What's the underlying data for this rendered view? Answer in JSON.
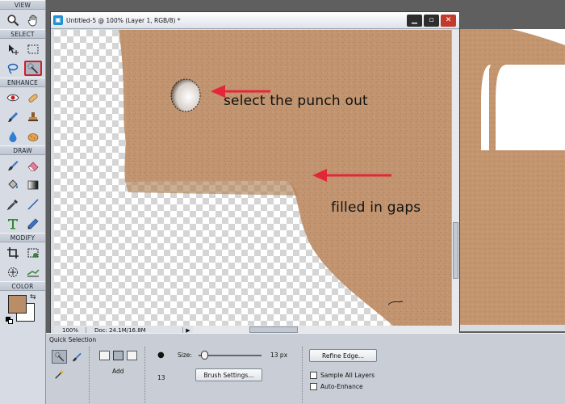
{
  "toolbox": {
    "sections": {
      "view": "VIEW",
      "select": "SELECT",
      "enhance": "ENHANCE",
      "draw": "DRAW",
      "modify": "MODIFY",
      "color": "COLOR"
    },
    "foreground_color": "#b98d68",
    "background_color": "#ffffff"
  },
  "document": {
    "title": "Untitled-5 @ 100% (Layer 1, RGB/8) *",
    "zoom": "100%",
    "doc_size": "Doc: 24.1M/16.8M",
    "annotations": {
      "punch_out": "select the punch out",
      "gaps": "filled in gaps"
    },
    "annotation_arrow_color": "#e4263b"
  },
  "options": {
    "tool_name": "Quick Selection",
    "mode_label": "Add",
    "brush_size_value": "13",
    "size_label": "Size:",
    "size_value": "13 px",
    "brush_settings_label": "Brush Settings...",
    "refine_edge_label": "Refine Edge...",
    "sample_all_layers_label": "Sample All Layers",
    "auto_enhance_label": "Auto-Enhance"
  }
}
